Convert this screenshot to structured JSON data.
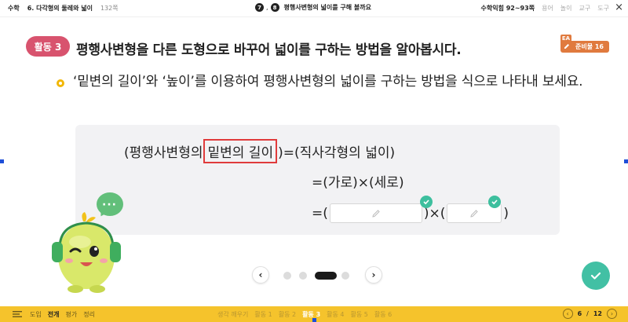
{
  "topbar": {
    "subject": "수학",
    "chapter": "6. 다각형의 둘레와 넓이",
    "page": "132쪽",
    "lesson_nums": [
      "7",
      "8"
    ],
    "lesson_title": "평행사변형의 넓이를 구해 볼까요",
    "workbook": "수학익힘 92~93쪽",
    "tools": [
      "용어",
      "놀이",
      "교구",
      "도구"
    ],
    "close": "×"
  },
  "activity": {
    "badge": "활동 3",
    "title": "평행사변형을 다른 도형으로 바꾸어 넓이를 구하는 방법을 알아봅시다.",
    "prep_tag": "EA",
    "prep_label": "준비물 16"
  },
  "instruction": "‘밑변의 길이’와 ‘높이’를 이용하여 평행사변형의 넓이를 구하는 방법을 식으로 나타내 보세요.",
  "formula": {
    "line1_prefix": "(평행사변형의",
    "line1_highlight": "밑변의 길이",
    "line1_suffix": ")=(직사각형의 넓이)",
    "line2": "=(가로)×(세로)",
    "line3_open": "=(",
    "line3_mid": ")×(",
    "line3_close": ")"
  },
  "character": {
    "bubble": "···"
  },
  "pagination": {
    "prev": "‹",
    "next": "›",
    "dots": 4,
    "active_index": 2
  },
  "bottombar": {
    "left_items": [
      "도입",
      "전개",
      "평가",
      "정리"
    ],
    "left_active": 1,
    "mid_items": [
      "생각 깨우기",
      "활동 1",
      "활동 2",
      "활동 3",
      "활동 4",
      "활동 5",
      "활동 6"
    ],
    "mid_active": 3,
    "page_current": "6",
    "page_sep": "/",
    "page_total": "12"
  },
  "colors": {
    "activity_badge": "#d8536e",
    "highlight_border": "#e03b3b",
    "check": "#3dbf9e",
    "bottombar": "#f5c32c",
    "character": "#d9e86a",
    "headphones": "#3fae5e"
  }
}
